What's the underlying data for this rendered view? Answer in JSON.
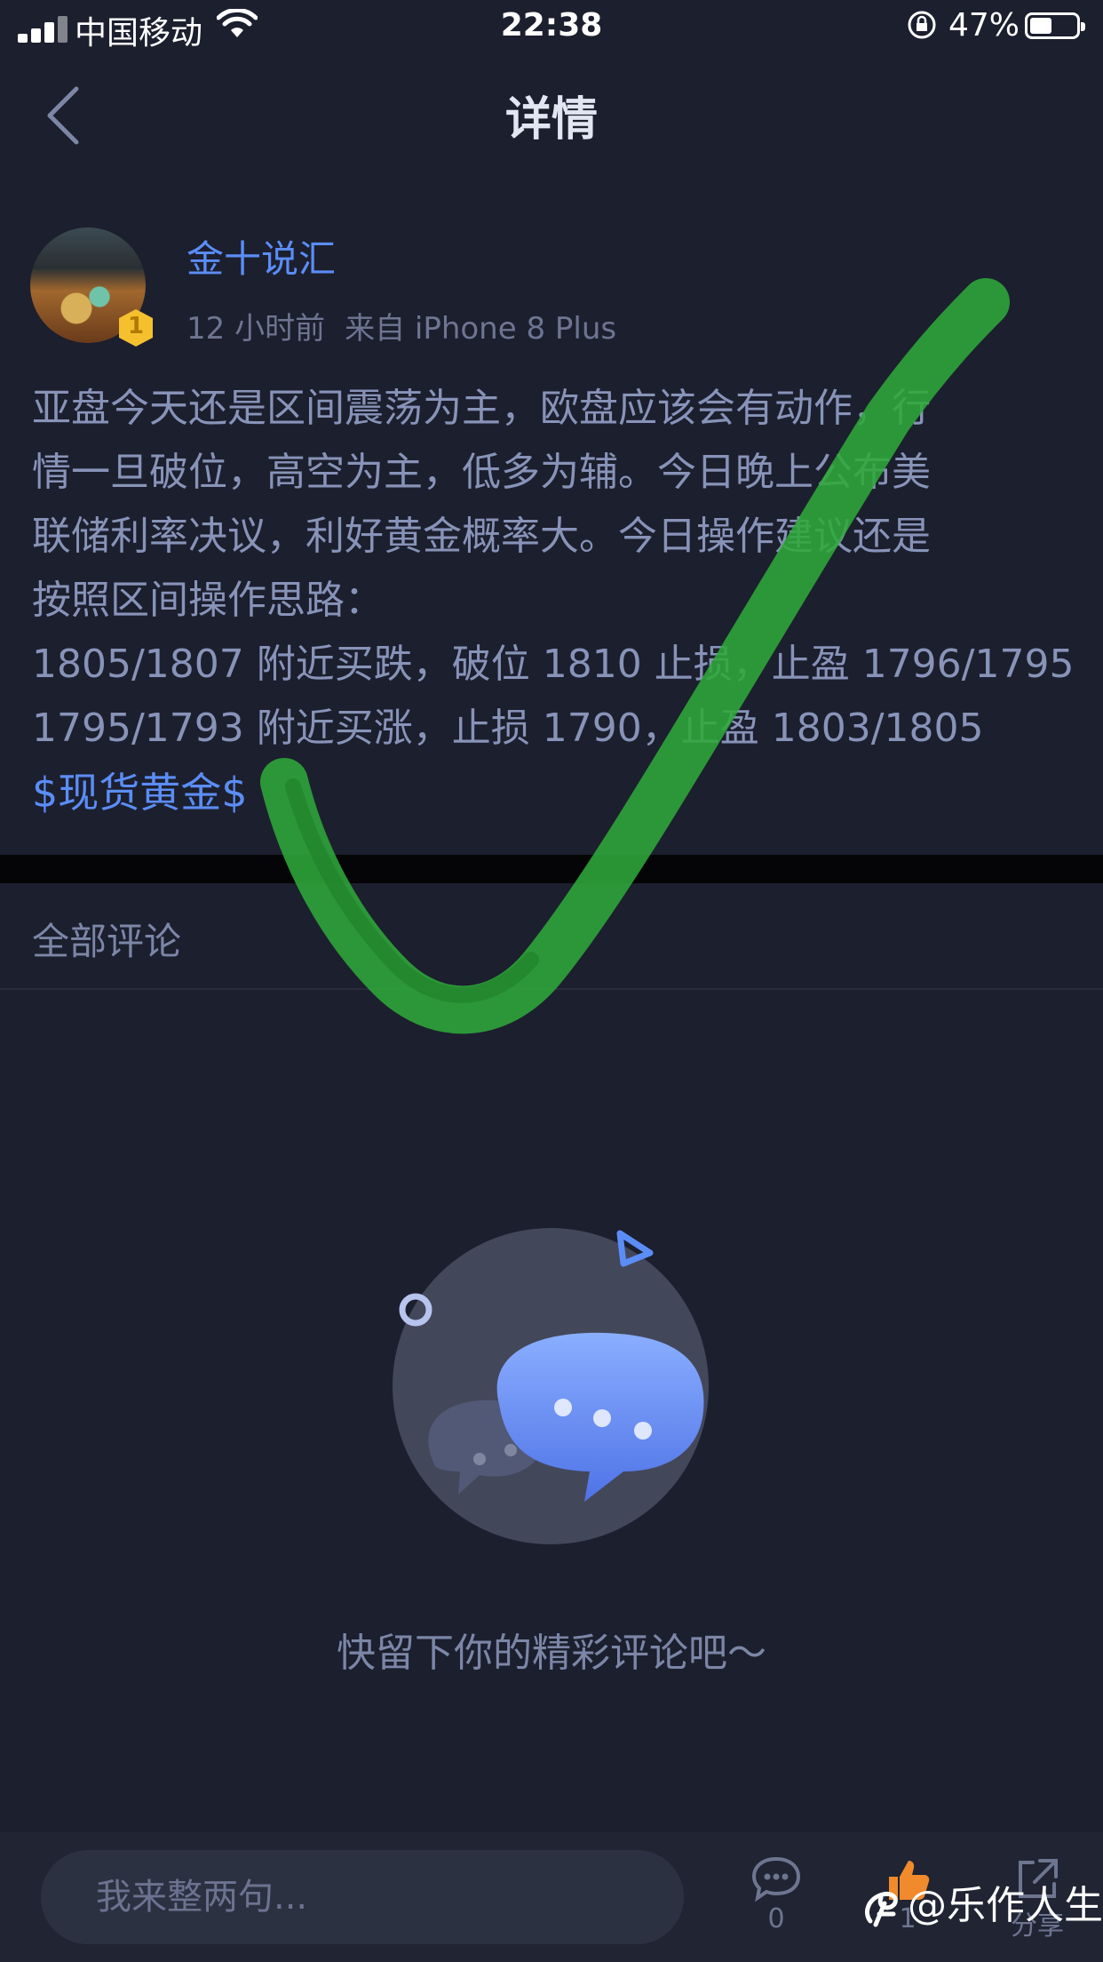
{
  "status_bar": {
    "carrier": "中国移动",
    "time": "22:38",
    "battery_percent": "47%",
    "battery_level": 0.47
  },
  "nav": {
    "title": "详情"
  },
  "post": {
    "author": "金十说汇",
    "level_badge": "1",
    "time_ago": "12 小时前",
    "source": "来自 iPhone 8 Plus",
    "lines": [
      "亚盘今天还是区间震荡为主，欧盘应该会有动作，行",
      "情一旦破位，高空为主，低多为辅。今日晚上公布美",
      "联储利率决议，利好黄金概率大。今日操作建议还是",
      "按照区间操作思路：",
      "1805/1807 附近买跌，破位 1810 止损，止盈 1796/1795",
      "1795/1793 附近买涨，止损 1790，止盈 1803/1805"
    ],
    "topic_tag": "$现货黄金$"
  },
  "comments": {
    "header": "全部评论",
    "empty_text": "快留下你的精彩评论吧～"
  },
  "bottom_bar": {
    "input_placeholder": "我来整两句...",
    "comment_count": "0",
    "like_count": "1",
    "share_label": "分享"
  },
  "watermark": {
    "text": "@乐作人生"
  },
  "colors": {
    "background": "#1c1f2e",
    "accent": "#5b8df6",
    "annotation_check": "#2fa83a"
  }
}
